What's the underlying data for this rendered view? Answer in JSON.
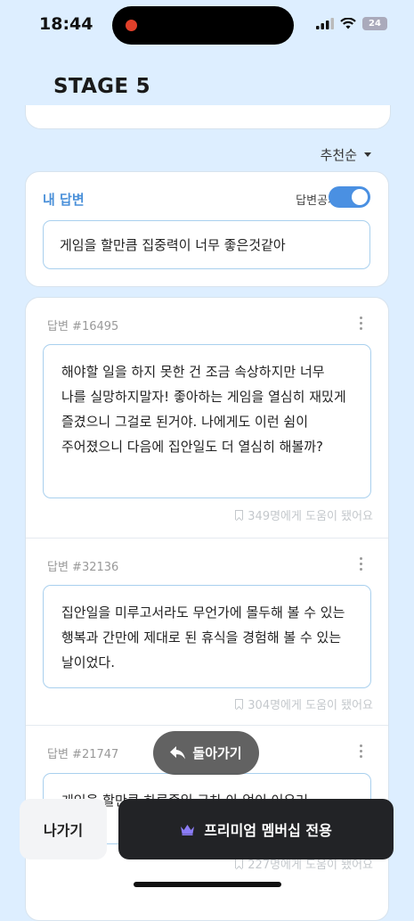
{
  "status_bar": {
    "time": "18:44",
    "battery": "24"
  },
  "header": {
    "title": "STAGE 5"
  },
  "sort": {
    "label": "추천순"
  },
  "my_answer": {
    "label": "내 답변",
    "public_toggle_label": "답변공개",
    "public_toggle_on": true,
    "text": "게임을 할만큼 집중력이 너무 좋은것같아"
  },
  "answers": [
    {
      "id": "답변 #16495",
      "text": "해야할 일을 하지 못한 건 조금 속상하지만 너무 나를 실망하지말자! 좋아하는 게임을 열심히 재밌게 즐겼으니 그걸로 된거야. 나에게도 이런 쉼이 주어졌으니 다음에 집안일도 더 열심히 해볼까?",
      "helpful": "349명에게 도움이 됐어요"
    },
    {
      "id": "답변 #32136",
      "text": "집안일을 미루고서라도 무언가에 몰두해 볼 수 있는 행복과 간만에 제대로 된 휴식을 경험해 볼 수 있는 날이었다.",
      "helpful": "304명에게 도움이 됐어요"
    },
    {
      "id": "답변 #21747",
      "text": "게임을 할만큼 하루종일 금차 아 없이 어우러",
      "helpful": "227명에게 도움이 됐어요"
    }
  ],
  "back_button": {
    "label": "돌아가기"
  },
  "footer": {
    "exit_label": "나가기",
    "premium_label": "프리미엄 멤버십 전용"
  },
  "colors": {
    "accent": "#4a90d9",
    "page_bg": "#ddeeff",
    "dark_button": "#222326",
    "crown": "#8b7cf6"
  }
}
